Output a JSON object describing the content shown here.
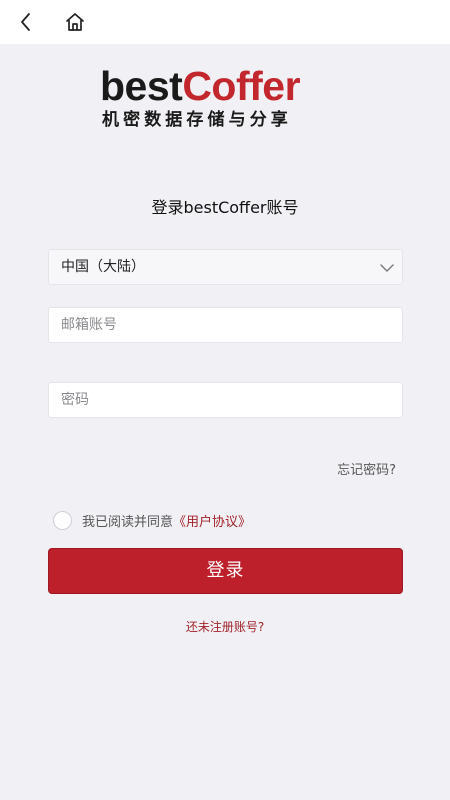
{
  "nav": {
    "back_icon": "chevron-left-icon",
    "home_icon": "home-icon"
  },
  "logo": {
    "word_best": "best",
    "word_coffer": "Coffer",
    "tagline": "机密数据存储与分享",
    "colors": {
      "dark": "#1a1a1a",
      "brand_red": "#c1272d"
    }
  },
  "form": {
    "title": "登录bestCoffer账号",
    "region": {
      "value": "中国（大陆）"
    },
    "email": {
      "placeholder": "邮箱账号",
      "value": ""
    },
    "password": {
      "placeholder": "密码",
      "value": ""
    },
    "forgot": "忘记密码?",
    "agree_text": "我已阅读并同意",
    "agree_link": "《用户协议》",
    "agree_checked": false,
    "login": "登录",
    "register": "还未注册账号?"
  },
  "colors": {
    "primary": "#bd1f2b",
    "link": "#a0232a",
    "background": "#f1f1f5"
  }
}
